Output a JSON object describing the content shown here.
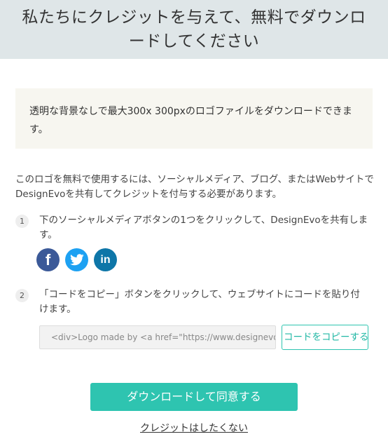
{
  "header": {
    "title": "私たちにクレジットを与えて、無料でダウンロードしてください"
  },
  "notice": {
    "text": "透明な背景なしで最大300x 300pxのロゴファイルをダウンロードできます。"
  },
  "intro": {
    "text": "このロゴを無料で使用するには、ソーシャルメディア、ブログ、またはWebサイトでDesignEvoを共有してクレジットを付与する必要があります。"
  },
  "steps": [
    {
      "number": "1",
      "text": "下のソーシャルメディアボタンの1つをクリックして、DesignEvoを共有します。"
    },
    {
      "number": "2",
      "text": "「コードをコピー」ボタンをクリックして、ウェブサイトにコードを貼り付けます。"
    }
  ],
  "social": [
    {
      "icon": "facebook-icon",
      "glyph": "f",
      "color": "#3b5998"
    },
    {
      "icon": "twitter-icon",
      "glyph": "",
      "color": "#1da1f2"
    },
    {
      "icon": "linkedin-icon",
      "glyph": "in",
      "color": "#0e76a8"
    }
  ],
  "code": {
    "value": "<div>Logo made by <a href=\"https://www.designevo."
  },
  "buttons": {
    "copy_label": "コードをコピーする",
    "agree_label": "ダウンロードして同意する",
    "no_credit_label": "クレジットはしたくない"
  },
  "colors": {
    "accent": "#2ec4b0",
    "header_bg": "#dfe6e8",
    "notice_bg": "#f7f6f0"
  }
}
